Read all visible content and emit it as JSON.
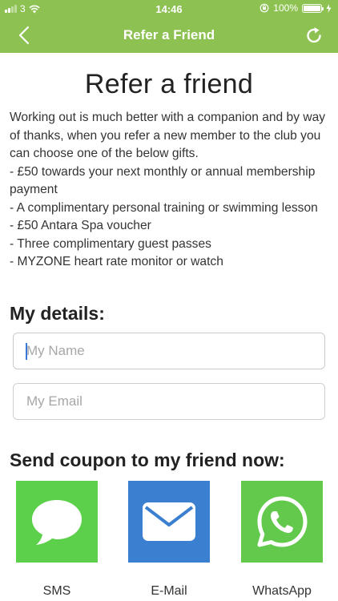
{
  "status_bar": {
    "carrier": "3",
    "time": "14:46",
    "battery": "100%"
  },
  "nav": {
    "title": "Refer a Friend",
    "back_icon": "chevron-left-icon",
    "refresh_icon": "refresh-icon"
  },
  "content": {
    "title": "Refer a friend",
    "intro_lines": [
      "Working out is much better with a companion and by way of thanks, when you refer a new member to the club you can choose one of the below gifts.",
      "- £50 towards your next monthly or annual membership payment",
      "- A complimentary personal training or swimming lesson",
      "- £50 Antara Spa voucher",
      "- Three complimentary guest passes",
      "- MYZONE heart rate monitor or watch"
    ]
  },
  "details": {
    "heading": "My details:",
    "name_placeholder": "My Name",
    "email_placeholder": "My Email"
  },
  "coupon": {
    "heading": "Send coupon to my friend now:",
    "options": [
      {
        "label": "SMS",
        "icon": "speech-bubble-icon",
        "color": "#5cd04a"
      },
      {
        "label": "E-Mail",
        "icon": "envelope-icon",
        "color": "#3b7fd0"
      },
      {
        "label": "WhatsApp",
        "icon": "whatsapp-icon",
        "color": "#62c94d"
      }
    ]
  },
  "colors": {
    "header": "#8dc252",
    "text": "#333333"
  }
}
